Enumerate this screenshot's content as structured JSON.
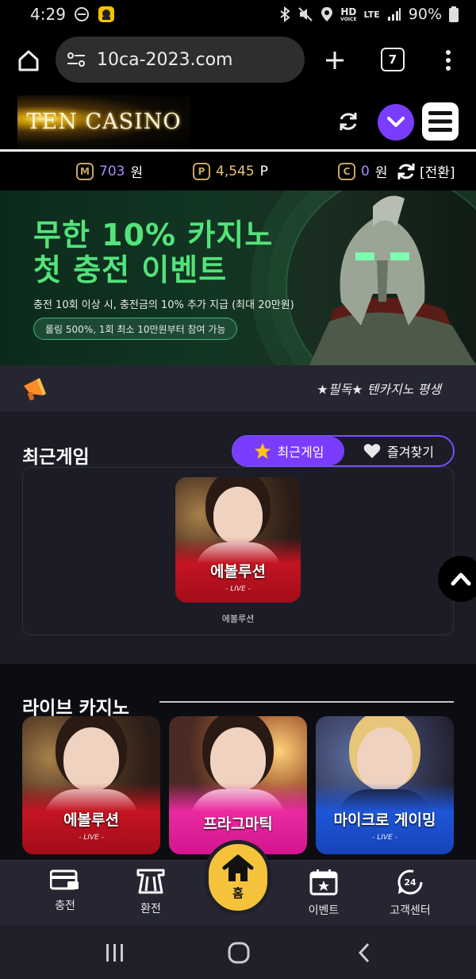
{
  "status_bar": {
    "time": "4:29",
    "hd_top": "HD",
    "hd_bottom": "VOICE",
    "lte": "LTE",
    "battery": "90%"
  },
  "browser": {
    "url": "10ca-2023.com",
    "tabs_count": "7"
  },
  "header": {
    "logo_text": "TEN CASINO"
  },
  "points": {
    "money_icon": "M",
    "money_value": "703",
    "money_unit": "원",
    "point_icon": "P",
    "point_value": "4,545",
    "point_unit": "P",
    "casino_icon": "C",
    "casino_value": "0",
    "casino_unit": "원",
    "convert_label": "[전환]"
  },
  "banner": {
    "title_line1": "무한 10% 카지노",
    "title_line2": "첫 충전 이벤트",
    "subtitle": "충전 10회 이상 시, 충전금의 10% 추가 지급 (최대 20만원)",
    "pill": "롤링 500%, 1회 최소 10만원부터 참여 가능"
  },
  "notice": {
    "text": "★필독★ 텐카지노 평생"
  },
  "recent": {
    "title": "최근게임",
    "tab_recent": "최근게임",
    "tab_favorite": "즐겨찾기",
    "game": {
      "name": "에볼루션",
      "live": "- LIVE -",
      "caption": "에볼루션"
    }
  },
  "live_casino": {
    "title": "라이브 카지노",
    "cards": [
      {
        "name": "에볼루션",
        "live": "- LIVE -"
      },
      {
        "name": "프라그마틱",
        "live": ""
      },
      {
        "name": "마이크로 게이밍",
        "live": "- LIVE -"
      }
    ]
  },
  "bottom_nav": {
    "charge": "충전",
    "exchange": "환전",
    "home": "홈",
    "event": "이벤트",
    "support": "고객센터",
    "support_badge": "24"
  },
  "colors": {
    "accent": "#7a3cff",
    "home": "#f5c33b",
    "banner_green": "#53e37a",
    "coin_gold": "#c9a46a"
  }
}
